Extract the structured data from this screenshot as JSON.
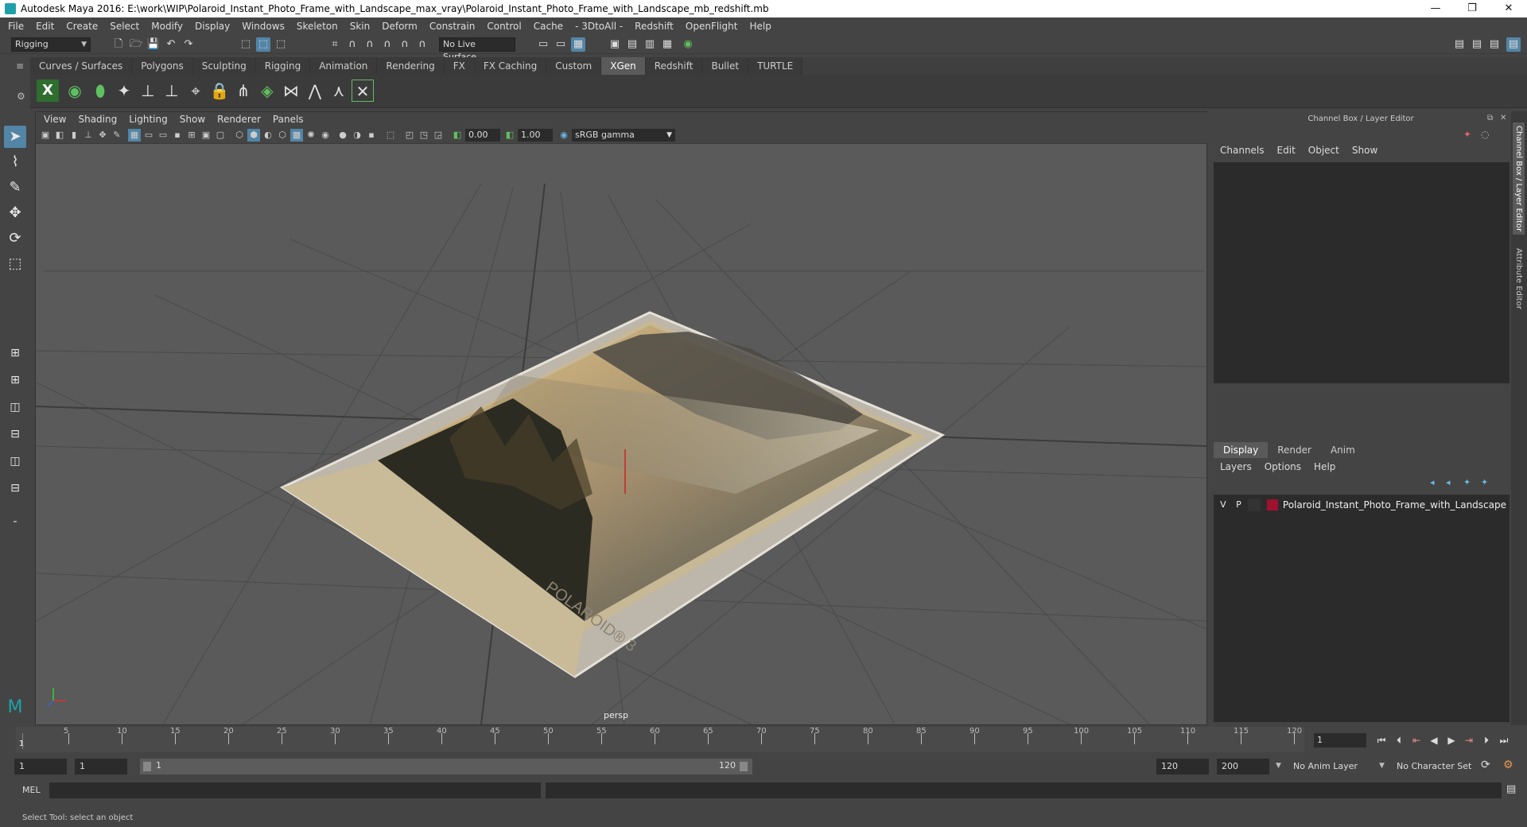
{
  "window": {
    "title": "Autodesk Maya 2016: E:\\work\\WIP\\Polaroid_Instant_Photo_Frame_with_Landscape_max_vray\\Polaroid_Instant_Photo_Frame_with_Landscape_mb_redshift.mb",
    "min": "—",
    "restore": "❐",
    "close": "✕"
  },
  "menubar": [
    "File",
    "Edit",
    "Create",
    "Select",
    "Modify",
    "Display",
    "Windows",
    "Skeleton",
    "Skin",
    "Deform",
    "Constrain",
    "Control",
    "Cache",
    "- 3DtoAll -",
    "Redshift",
    "OpenFlight",
    "Help"
  ],
  "statusline": {
    "mode": "Rigging",
    "live_surface": "No Live Surface"
  },
  "shelf_tabs": [
    "Curves / Surfaces",
    "Polygons",
    "Sculpting",
    "Rigging",
    "Animation",
    "Rendering",
    "FX",
    "FX Caching",
    "Custom",
    "XGen",
    "Redshift",
    "Bullet",
    "TURTLE"
  ],
  "active_shelf": "XGen",
  "viewport": {
    "menu": [
      "View",
      "Shading",
      "Lighting",
      "Show",
      "Renderer",
      "Panels"
    ],
    "exposure": "0.00",
    "gamma": "1.00",
    "color_space": "sRGB gamma",
    "camera": "persp",
    "frame_text": "POLAROID® 3"
  },
  "channel_box": {
    "title": "Channel Box / Layer Editor",
    "menu": [
      "Channels",
      "Edit",
      "Object",
      "Show"
    ]
  },
  "layer_editor": {
    "tabs": [
      "Display",
      "Render",
      "Anim"
    ],
    "active_tab": "Display",
    "menu": [
      "Layers",
      "Options",
      "Help"
    ],
    "layer": {
      "visible": "V",
      "playback": "P",
      "name": "Polaroid_Instant_Photo_Frame_with_Landscape",
      "color": "#a0112f"
    }
  },
  "side_tabs": [
    "Channel Box / Layer Editor",
    "Attribute Editor"
  ],
  "timeline": {
    "ticks": [
      "5",
      "10",
      "15",
      "20",
      "25",
      "30",
      "35",
      "40",
      "45",
      "50",
      "55",
      "60",
      "65",
      "70",
      "75",
      "80",
      "85",
      "90",
      "95",
      "100",
      "105",
      "110",
      "115",
      "120"
    ],
    "current_frame": "1"
  },
  "range": {
    "start": "1",
    "playback_start": "1",
    "range_start_label": "1",
    "range_end_label": "120",
    "playback_end": "120",
    "end": "200",
    "anim_layer": "No Anim Layer",
    "character_set": "No Character Set"
  },
  "command_line": {
    "label": "MEL"
  },
  "status": {
    "help": "Select Tool: select an object"
  }
}
